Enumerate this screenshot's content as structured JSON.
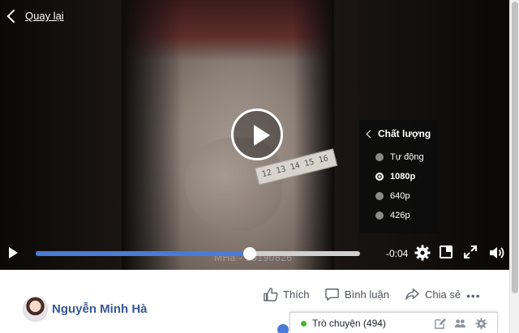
{
  "header": {
    "back_label": "Quay lại"
  },
  "player": {
    "watermark": "MHa - 20190826",
    "time_remaining": "-0:04",
    "progress": 0.66,
    "quality_menu": {
      "title": "Chất lượng",
      "options": [
        {
          "label": "Tự động",
          "selected": false
        },
        {
          "label": "1080p",
          "selected": true
        },
        {
          "label": "640p",
          "selected": false
        },
        {
          "label": "426p",
          "selected": false
        }
      ]
    },
    "tape_marks": [
      "12",
      "13",
      "14",
      "15",
      "16"
    ]
  },
  "post": {
    "author": "Nguyễn Minh Hà",
    "actions": {
      "like": "Thích",
      "comment": "Bình luận",
      "share": "Chia sẻ",
      "more": "•••"
    }
  },
  "chat": {
    "label": "Trò chuyện (494)"
  },
  "colors": {
    "accent": "#4a7bd7",
    "link": "#385898",
    "online": "#42b72a"
  }
}
